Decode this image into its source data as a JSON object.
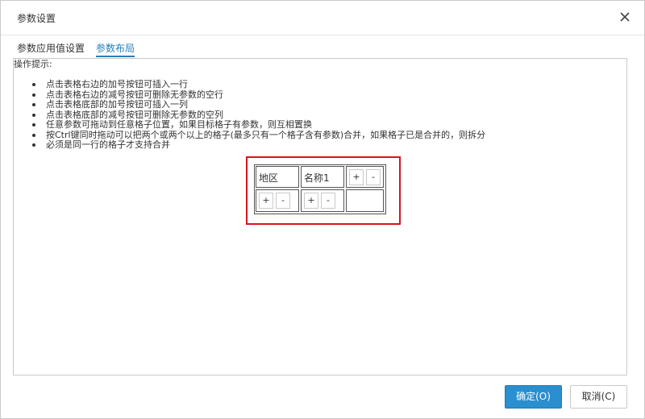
{
  "dialog": {
    "title": "参数设置",
    "close_icon": "close-icon"
  },
  "tabs": [
    {
      "label": "参数应用值设置",
      "active": false
    },
    {
      "label": "参数布局",
      "active": true
    }
  ],
  "hint": {
    "title": "操作提示:",
    "items": [
      "点击表格右边的加号按钮可插入一行",
      "点击表格右边的减号按钮可删除无参数的空行",
      "点击表格底部的加号按钮可插入一列",
      "点击表格底部的减号按钮可删除无参数的空列",
      "任意参数可拖动到任意格子位置，如果目标格子有参数，则互相置换",
      "按Ctrl键同时拖动可以把两个或两个以上的格子(最多只有一个格子含有参数)合并，如果格子已是合并的，则拆分",
      "必须是同一行的格子才支持合并"
    ]
  },
  "layout_grid": {
    "cells": [
      "地区",
      "名称1"
    ],
    "plus_label": "+",
    "minus_label": "-"
  },
  "colors": {
    "accent": "#2a8fcf",
    "tab_active": "#2a7fb8",
    "highlight_border": "#d9141b"
  },
  "buttons": {
    "ok": "确定(O)",
    "cancel": "取消(C)"
  }
}
